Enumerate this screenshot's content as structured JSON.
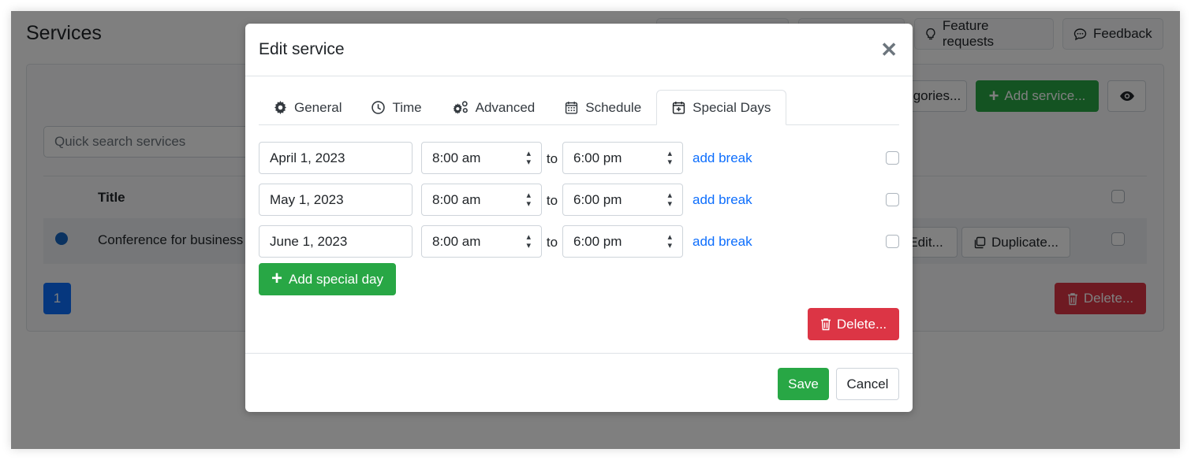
{
  "page": {
    "title": "Services",
    "top_buttons": [
      {
        "label": "",
        "icon": "blank"
      },
      {
        "label": "",
        "icon": "blank"
      },
      {
        "label": "Feature requests",
        "icon": "lightbulb-icon"
      },
      {
        "label": "Feedback",
        "icon": "chat-icon"
      }
    ],
    "toolbar": {
      "categories_label": "Categories...",
      "add_service_label": "Add service...",
      "visibility_icon": "eye-icon"
    },
    "search": {
      "placeholder": "Quick search services"
    },
    "table": {
      "headers": [
        "",
        "Title"
      ],
      "rows": [
        {
          "color": "#1565c0",
          "title": "Conference for business",
          "actions": [
            "Edit...",
            "Duplicate..."
          ]
        }
      ]
    },
    "pagination": {
      "current": "1"
    },
    "delete_label": "Delete..."
  },
  "modal": {
    "title": "Edit service",
    "close_icon": "close-icon",
    "tabs": [
      {
        "label": "General",
        "icon": "gear-icon",
        "active": false
      },
      {
        "label": "Time",
        "icon": "clock-icon",
        "active": false
      },
      {
        "label": "Advanced",
        "icon": "gears-icon",
        "active": false
      },
      {
        "label": "Schedule",
        "icon": "calendar-icon",
        "active": false
      },
      {
        "label": "Special Days",
        "icon": "calendar-plus-icon",
        "active": true
      }
    ],
    "special_days": [
      {
        "date": "April 1, 2023",
        "start": "8:00 am",
        "to": "to",
        "end": "6:00 pm",
        "break_label": "add break",
        "checked": false
      },
      {
        "date": "May 1, 2023",
        "start": "8:00 am",
        "to": "to",
        "end": "6:00 pm",
        "break_label": "add break",
        "checked": false
      },
      {
        "date": "June 1, 2023",
        "start": "8:00 am",
        "to": "to",
        "end": "6:00 pm",
        "break_label": "add break",
        "checked": false
      }
    ],
    "add_special_day_label": "Add special day",
    "delete_label": "Delete...",
    "save_label": "Save",
    "cancel_label": "Cancel"
  },
  "colors": {
    "primary": "#0d6efd",
    "success": "#28a745",
    "danger": "#dc3545"
  }
}
